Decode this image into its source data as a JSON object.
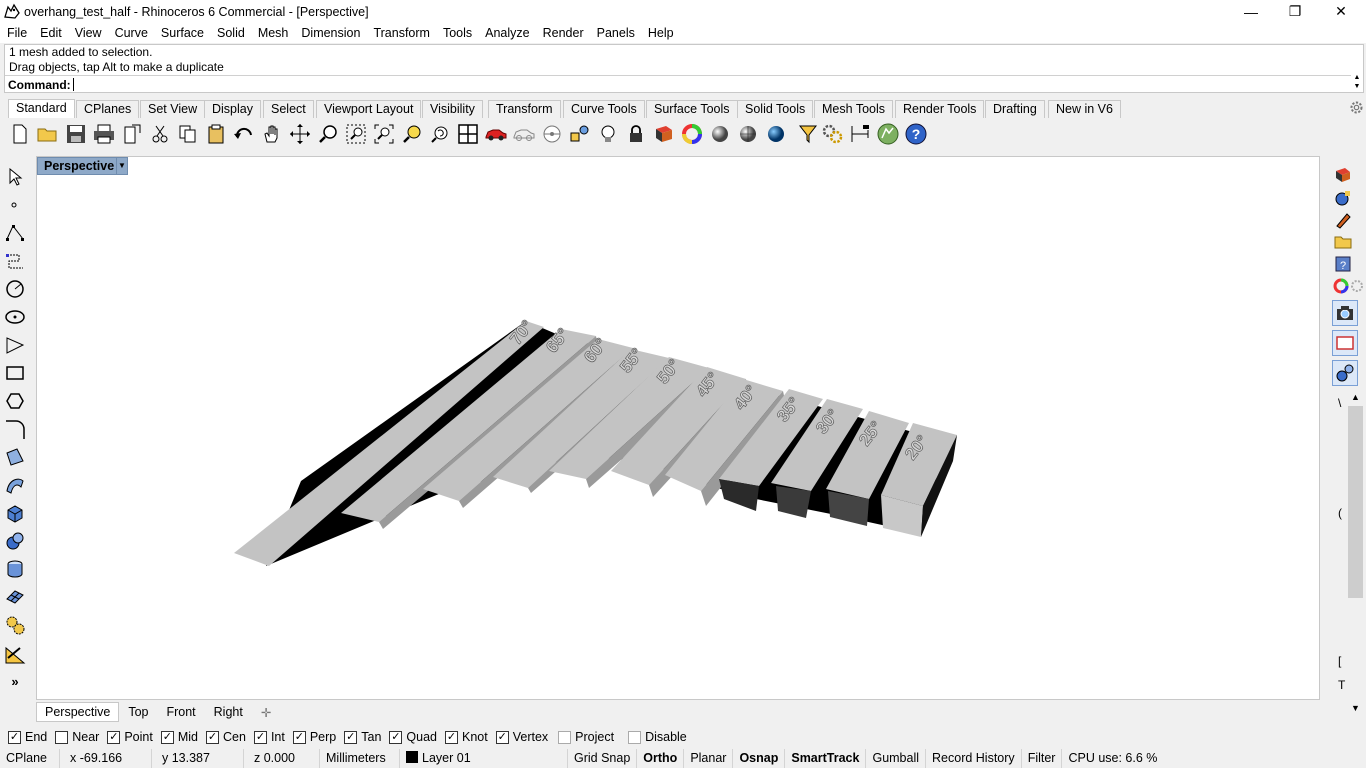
{
  "window": {
    "title": "overhang_test_half - Rhinoceros 6 Commercial - [Perspective]",
    "minimize": "—",
    "maximize": "❐",
    "close": "✕"
  },
  "menu": [
    "File",
    "Edit",
    "View",
    "Curve",
    "Surface",
    "Solid",
    "Mesh",
    "Dimension",
    "Transform",
    "Tools",
    "Analyze",
    "Render",
    "Panels",
    "Help"
  ],
  "command": {
    "history": [
      "1 mesh added to selection.",
      "Drag objects, tap Alt to make a duplicate"
    ],
    "prompt_label": "Command:",
    "value": ""
  },
  "toolbar_tabs": [
    "Standard",
    "CPlanes",
    "Set View",
    "Display",
    "Select",
    "Viewport Layout",
    "Visibility",
    "Transform",
    "Curve Tools",
    "Surface Tools",
    "Solid Tools",
    "Mesh Tools",
    "Render Tools",
    "Drafting",
    "New in V6"
  ],
  "active_tab": "Standard",
  "viewport": {
    "label": "Perspective",
    "model_labels": [
      "70°",
      "65°",
      "60°",
      "55°",
      "50°",
      "45°",
      "40°",
      "35°",
      "30°",
      "25°",
      "20°"
    ]
  },
  "view_tabs": [
    "Perspective",
    "Top",
    "Front",
    "Right"
  ],
  "view_tab_add": "✛",
  "osnaps": [
    {
      "label": "End",
      "checked": true
    },
    {
      "label": "Near",
      "checked": false
    },
    {
      "label": "Point",
      "checked": true
    },
    {
      "label": "Mid",
      "checked": true
    },
    {
      "label": "Cen",
      "checked": true
    },
    {
      "label": "Int",
      "checked": true
    },
    {
      "label": "Perp",
      "checked": true
    },
    {
      "label": "Tan",
      "checked": true
    },
    {
      "label": "Quad",
      "checked": true
    },
    {
      "label": "Knot",
      "checked": true
    },
    {
      "label": "Vertex",
      "checked": true
    },
    {
      "label": "Project",
      "checked": false
    },
    {
      "label": "Disable",
      "checked": false
    }
  ],
  "status": {
    "cplane": "CPlane",
    "x": "x -69.166",
    "y": "y 13.387",
    "z": "z 0.000",
    "units": "Millimeters",
    "layer": "Layer 01",
    "grid_snap": "Grid Snap",
    "ortho": "Ortho",
    "planar": "Planar",
    "osnap": "Osnap",
    "smarttrack": "SmartTrack",
    "gumball": "Gumball",
    "record_history": "Record History",
    "filter": "Filter",
    "cpu": "CPU use: 6.6 %"
  },
  "colors": {
    "viewport_label_bg": "#8ea9c8",
    "model_light": "#c3c3c3",
    "model_shadow": "#000000"
  }
}
